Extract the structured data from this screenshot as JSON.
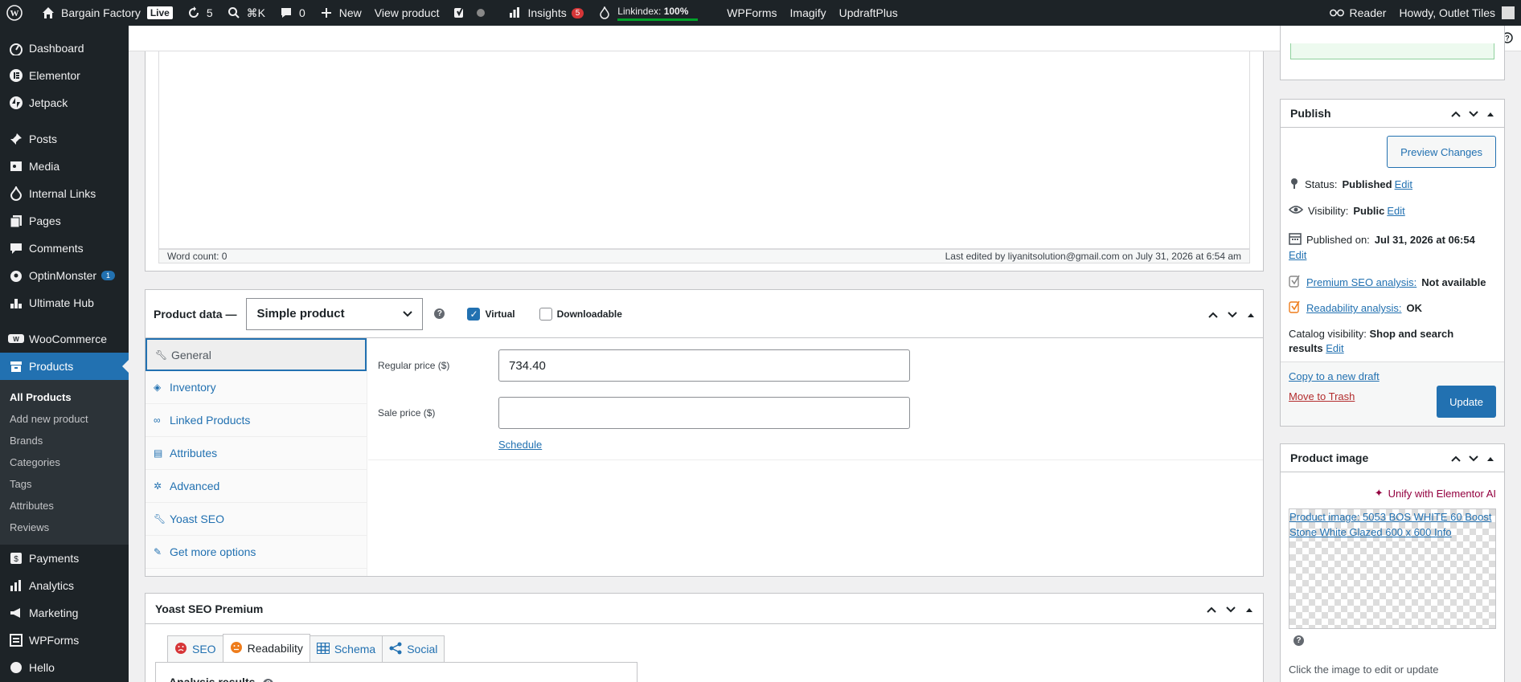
{
  "adminbar": {
    "site_name": "Bargain Factory",
    "live_label": "Live",
    "updates_count": "5",
    "search_shortcut": "⌘K",
    "comments_count": "0",
    "new_label": "New",
    "view_product": "View product",
    "insights_label": "Insights",
    "insights_count": "5",
    "linkindex_label": "Linkindex:",
    "linkindex_value": "100%",
    "wpforms": "WPForms",
    "imagify": "Imagify",
    "updraft": "UpdraftPlus",
    "reader": "Reader",
    "howdy": "Howdy, Outlet Tiles"
  },
  "sidebar": {
    "items": [
      {
        "label": "Dashboard"
      },
      {
        "label": "Elementor"
      },
      {
        "label": "Jetpack"
      },
      {
        "label": "Posts"
      },
      {
        "label": "Media"
      },
      {
        "label": "Internal Links"
      },
      {
        "label": "Pages"
      },
      {
        "label": "Comments"
      },
      {
        "label": "OptinMonster",
        "badge": "1"
      },
      {
        "label": "Ultimate Hub"
      },
      {
        "label": "WooCommerce"
      },
      {
        "label": "Products"
      },
      {
        "label": "Payments"
      },
      {
        "label": "Analytics"
      },
      {
        "label": "Marketing"
      },
      {
        "label": "WPForms"
      },
      {
        "label": "Hello"
      }
    ],
    "submenu": [
      "All Products",
      "Add new product",
      "Brands",
      "Categories",
      "Tags",
      "Attributes",
      "Reviews"
    ]
  },
  "editor": {
    "word_count": "Word count: 0",
    "last_edited": "Last edited by liyanitsolution@gmail.com on July 31, 2026 at 6:54 am"
  },
  "product_data": {
    "title": "Product data —",
    "type_value": "Simple product",
    "virtual_label": "Virtual",
    "downloadable_label": "Downloadable",
    "tabs": [
      "General",
      "Inventory",
      "Linked Products",
      "Attributes",
      "Advanced",
      "Yoast SEO",
      "Get more options"
    ],
    "regular_price_label": "Regular price ($)",
    "regular_price_value": "734.40",
    "sale_price_label": "Sale price ($)",
    "sale_price_value": "",
    "schedule_link": "Schedule"
  },
  "yoast": {
    "title": "Yoast SEO Premium",
    "tabs": [
      "SEO",
      "Readability",
      "Schema",
      "Social"
    ],
    "analysis_results": "Analysis results"
  },
  "publish": {
    "title": "Publish",
    "preview_button": "Preview Changes",
    "status_label": "Status:",
    "status_value": "Published",
    "visibility_label": "Visibility:",
    "visibility_value": "Public",
    "published_label": "Published on:",
    "published_value": "Jul 31, 2026 at 06:54",
    "edit": "Edit",
    "premium_seo_link": "Premium SEO analysis:",
    "premium_seo_value": "Not available",
    "readability_link": "Readability analysis:",
    "readability_value": "OK",
    "catalog_label": "Catalog visibility:",
    "catalog_value": "Shop and search results",
    "copy_draft": "Copy to a new draft",
    "trash": "Move to Trash",
    "update_button": "Update"
  },
  "product_image": {
    "title": "Product image",
    "unify": "Unify with Elementor AI",
    "image_alt": "Product image: 5053 BOS WHITE 60 Boost Stone White Glazed 600 x 600 Info",
    "hint": "Click the image to edit or update"
  },
  "colors": {
    "admin_dark": "#1d2327",
    "accent": "#2271b1",
    "elementor_ai": "#93003f"
  }
}
